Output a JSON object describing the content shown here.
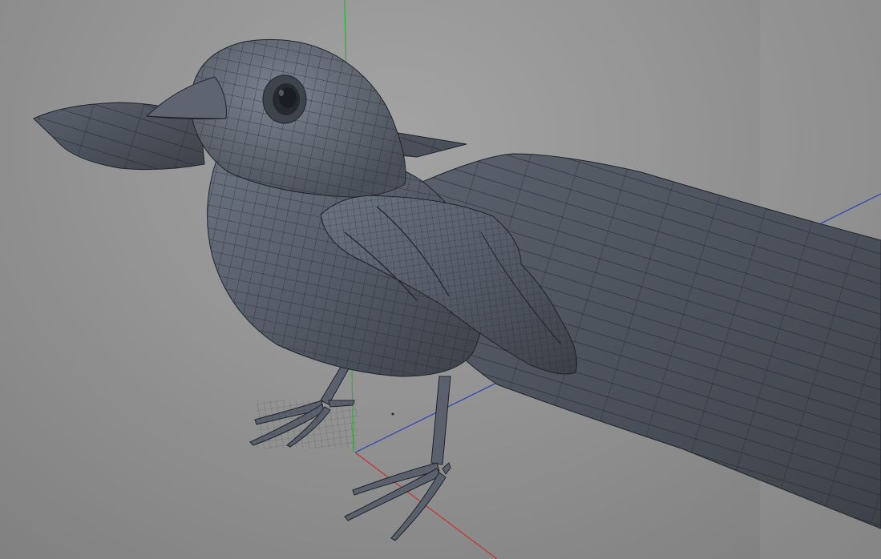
{
  "viewport": {
    "background_color": "#8f8f8f",
    "model_color": "#4e5560",
    "wire_color": "#1f232a",
    "axes": {
      "x_color": "#c8302c",
      "y_color": "#2fae3a",
      "z_color": "#2b3fb5"
    }
  }
}
